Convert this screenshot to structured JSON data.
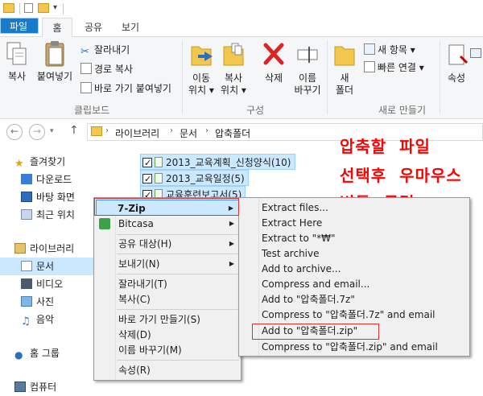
{
  "ribbon": {
    "tabs": [
      {
        "label": "파일"
      },
      {
        "label": "홈"
      },
      {
        "label": "공유"
      },
      {
        "label": "보기"
      }
    ],
    "clipboard": {
      "copy": "복사",
      "paste": "붙여넣기",
      "cut": "잘라내기",
      "copy_path": "경로 복사",
      "paste_shortcut": "바로 가기 붙여넣기",
      "group": "클립보드"
    },
    "organize": {
      "move_to_1": "이동",
      "move_to_2": "위치 ▾",
      "copy_to_1": "복사",
      "copy_to_2": "위치 ▾",
      "delete": "삭제",
      "rename_1": "이름",
      "rename_2": "바꾸기",
      "group": "구성"
    },
    "new": {
      "new_folder_1": "새",
      "new_folder_2": "폴더",
      "new_item": "새 항목 ▾",
      "easy_access": "빠른 연결 ▾",
      "group": "새로 만들기"
    },
    "open": {
      "properties": "속성"
    }
  },
  "address": {
    "crumbs": [
      "라이브러리",
      "문서",
      "압축폴더"
    ]
  },
  "nav": {
    "favorites": "즐겨찾기",
    "downloads": "다운로드",
    "desktop": "바탕 화면",
    "recent": "최근 위치",
    "libraries": "라이브러리",
    "documents": "문서",
    "videos": "비디오",
    "pictures": "사진",
    "music": "음악",
    "homegroup": "홈 그룹",
    "computer": "컴퓨터"
  },
  "files": [
    "2013_교육계획_신청양식(10)",
    "2013_교육일정(5)",
    "교육훈련보고서(5)"
  ],
  "annotation": {
    "line1": "압축할  파일",
    "line2": "선택후  우마우스",
    "line3": "버튼  클릭"
  },
  "context_menu": {
    "items": [
      "7-Zip",
      "Bitcasa",
      "공유 대상(H)",
      "보내기(N)",
      "잘라내기(T)",
      "복사(C)",
      "바로 가기 만들기(S)",
      "삭제(D)",
      "이름 바꾸기(M)",
      "속성(R)"
    ]
  },
  "zip_menu": {
    "items": [
      "Extract files...",
      "Extract Here",
      "Extract to \"*₩\"",
      "Test archive",
      "Add to archive...",
      "Compress and email...",
      "Add to \"압축폴더.7z\"",
      "Compress to \"압축폴더.7z\" and email",
      "Add to \"압축폴더.zip\"",
      "Compress to \"압축폴더.zip\" and email"
    ]
  },
  "colors": {
    "file_tab": "#1979ca",
    "selection": "#cce8ff",
    "annotation": "#ff0000",
    "highlight_box": "#e03030"
  }
}
